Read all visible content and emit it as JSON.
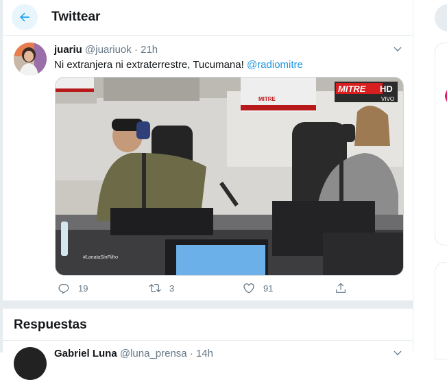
{
  "header": {
    "back_icon": "arrow-left-icon",
    "title": "Twittear"
  },
  "tweet": {
    "author_name": "juariu",
    "author_handle": "@juariuok",
    "separator": "·",
    "time": "21h",
    "text_before_mention": "Ni extranjera ni extraterrestre, Tucumana! ",
    "mention": "@radiomitre",
    "media": {
      "type": "video",
      "channel_badge": "MITRE",
      "channel_badge_hd": "HD",
      "channel_badge_sub": "VIVO",
      "bottom_hashtag": "#LanataSinFiltro",
      "sign_label": "MITRE"
    },
    "actions": {
      "reply_count": "19",
      "retweet_count": "3",
      "like_count": "91"
    }
  },
  "replies": {
    "title": "Respuestas",
    "first": {
      "name": "Gabriel Luna",
      "handle": "@luna_prensa",
      "separator": "·",
      "time": "14h"
    }
  },
  "colors": {
    "accent": "#1da1f2",
    "mention": "#1b95e0",
    "muted": "#657786",
    "border": "#e6ecf0"
  }
}
